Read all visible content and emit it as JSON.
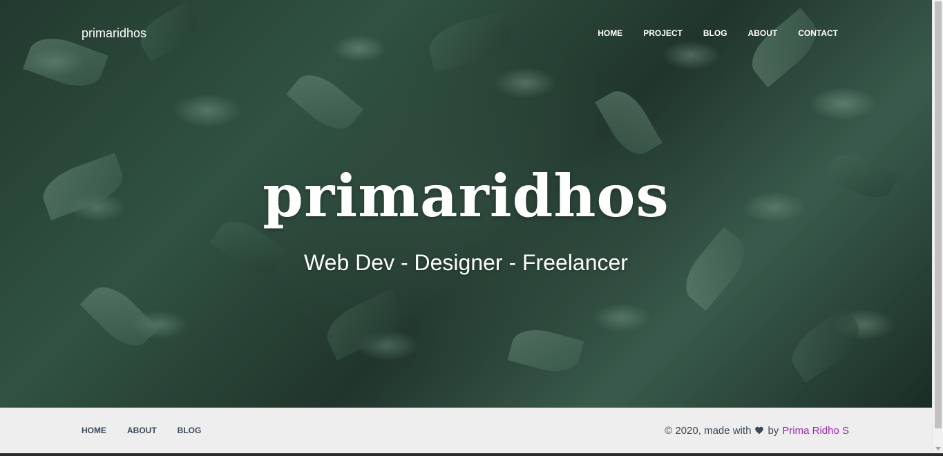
{
  "navbar": {
    "brand": "primaridhos",
    "links": [
      "HOME",
      "PROJECT",
      "BLOG",
      "ABOUT",
      "CONTACT"
    ]
  },
  "hero": {
    "title": "primaridhos",
    "subtitle": "Web Dev - Designer - Freelancer"
  },
  "footer": {
    "links": [
      "HOME",
      "ABOUT",
      "BLOG"
    ],
    "copyright_prefix": "© 2020, made with",
    "by": "by",
    "author": "Prima Ridho S",
    "heart_icon": "heart-icon",
    "author_color": "#9c27b0"
  }
}
